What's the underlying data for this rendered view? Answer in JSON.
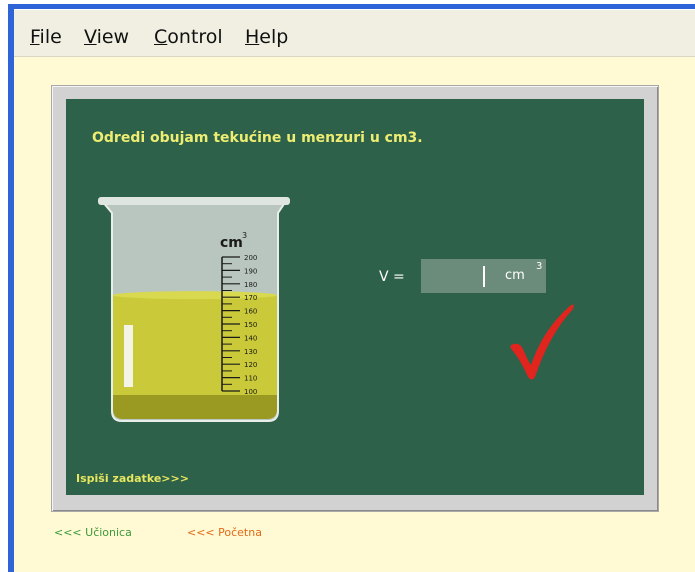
{
  "menu": {
    "file_first": "F",
    "file_rest": "ile",
    "view_first": "V",
    "view_rest": "iew",
    "control_first": "C",
    "control_rest": "ontrol",
    "help_first": "H",
    "help_rest": "elp"
  },
  "board": {
    "question": "Odredi obujam tekućine u menzuri u cm3.",
    "v_label": "V =",
    "answer_value": "",
    "unit": "cm",
    "unit_sup": "3",
    "tasks_link": "Ispiši zadatke>>>",
    "beaker_unit": "cm",
    "beaker_unit_sup": "3",
    "scale_labels": [
      "200",
      "190",
      "180",
      "170",
      "160",
      "150",
      "140",
      "130",
      "120",
      "110",
      "100"
    ],
    "fill_level_fraction": 0.7,
    "checkmark_color": "#e0241e",
    "board_color": "#2e6149"
  },
  "nav": {
    "classroom_link": "<<< Učionica",
    "home_link": "<<< Početna"
  },
  "colors": {
    "text_yellow": "#eded72",
    "liquid": "#c9c93a",
    "nav_green": "#3c9a3c",
    "nav_orange": "#e06a17"
  }
}
